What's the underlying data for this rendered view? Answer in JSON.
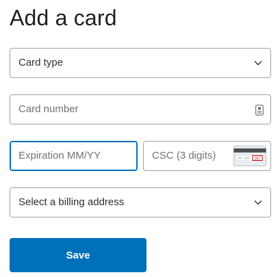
{
  "page": {
    "title": "Add a card"
  },
  "form": {
    "card_type": {
      "value": "Card type",
      "icon": "chevron-down-icon"
    },
    "card_number": {
      "placeholder": "Card number",
      "icon": "card-number-icon"
    },
    "expiration": {
      "placeholder": "Expiration MM/YY",
      "focused": true
    },
    "csc": {
      "placeholder": "CSC (3 digits)",
      "icon": "card-back-csc-icon",
      "icon_digits": "257"
    },
    "billing_address": {
      "value": "Select a billing address",
      "icon": "chevron-down-icon"
    },
    "save_label": "Save"
  },
  "colors": {
    "accent": "#0070ba",
    "border": "#9da3a6",
    "placeholder": "#6c7378",
    "text": "#2c2e2f",
    "csc_highlight": "#d20000"
  }
}
